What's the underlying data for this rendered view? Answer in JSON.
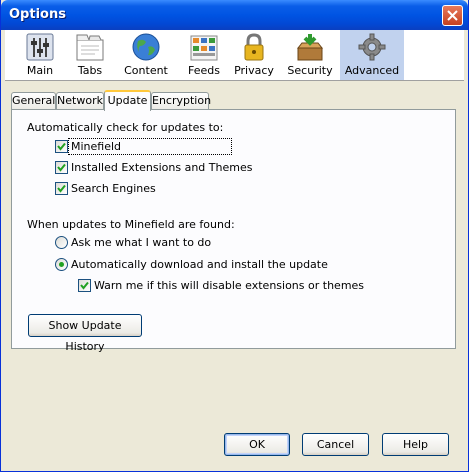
{
  "window": {
    "title": "Options"
  },
  "panes": [
    {
      "label": "Main",
      "icon": "main-sliders-icon"
    },
    {
      "label": "Tabs",
      "icon": "tabs-icon"
    },
    {
      "label": "Content",
      "icon": "content-globe-icon"
    },
    {
      "label": "Feeds",
      "icon": "feeds-icon"
    },
    {
      "label": "Privacy",
      "icon": "privacy-lock-icon"
    },
    {
      "label": "Security",
      "icon": "security-icon"
    },
    {
      "label": "Advanced",
      "icon": "advanced-gear-icon",
      "selected": true
    }
  ],
  "tabs": [
    {
      "label": "General"
    },
    {
      "label": "Network"
    },
    {
      "label": "Update",
      "active": true
    },
    {
      "label": "Encryption"
    }
  ],
  "update": {
    "auto_check_label": "Automatically check for updates to:",
    "checkboxes": [
      {
        "label": "Minefield",
        "checked": true
      },
      {
        "label": "Installed Extensions and Themes",
        "checked": true
      },
      {
        "label": "Search Engines",
        "checked": true
      }
    ],
    "when_found_label": "When updates to Minefield are found:",
    "radios": [
      {
        "label": "Ask me what I want to do",
        "selected": false
      },
      {
        "label": "Automatically download and install the update",
        "selected": true
      }
    ],
    "warn_checkbox": {
      "label": "Warn me if this will disable extensions or themes",
      "checked": true
    },
    "history_button": "Show Update History"
  },
  "buttons": {
    "ok": "OK",
    "cancel": "Cancel",
    "help": "Help"
  },
  "colors": {
    "titlebar": "#0054e3",
    "selected_pane": "#c1d2ee",
    "active_tab_accent": "#ffc83c",
    "radio_dot": "#21a121"
  }
}
